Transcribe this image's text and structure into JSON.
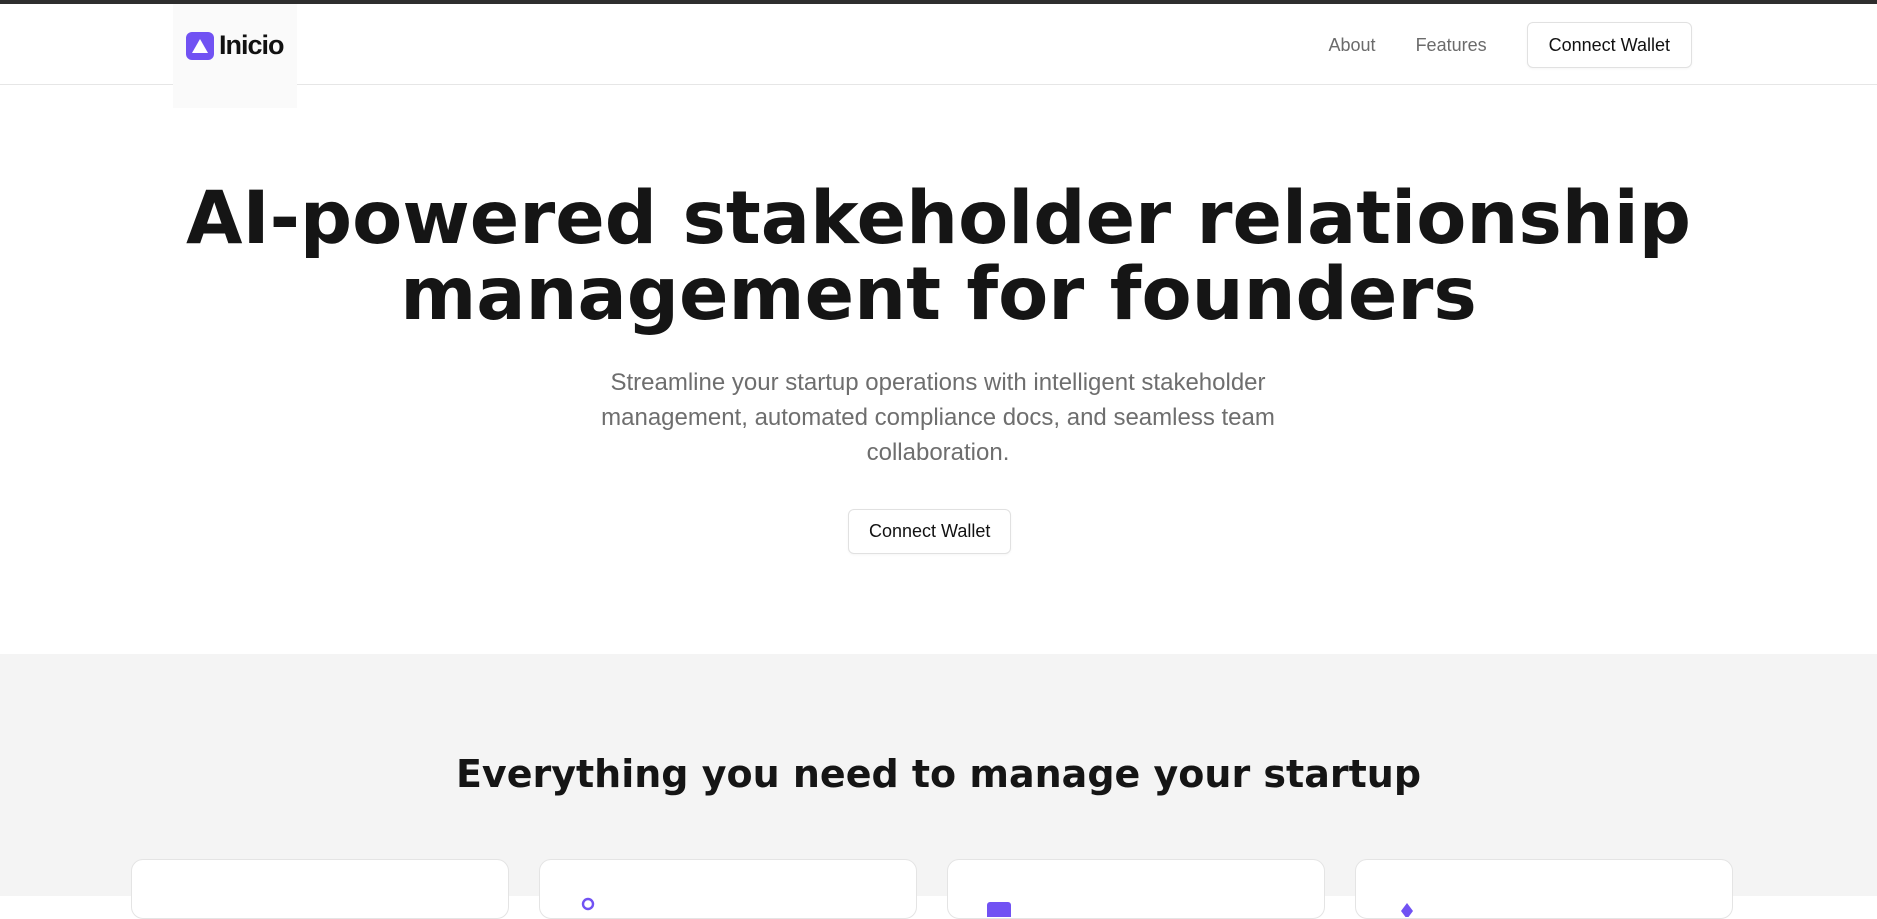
{
  "brand": {
    "name": "Inicio",
    "accent": "#7152f3"
  },
  "nav": {
    "links": [
      "About",
      "Features"
    ],
    "cta": "Connect Wallet"
  },
  "hero": {
    "title_line1": "AI-powered stakeholder relationship",
    "title_line2": "management for founders",
    "subtitle": "Streamline your startup operations with intelligent stakeholder management, automated compliance docs, and seamless team collaboration.",
    "cta": "Connect Wallet"
  },
  "features": {
    "title": "Everything you need to manage your startup",
    "cards": [
      {
        "icon": "users-icon"
      },
      {
        "icon": "document-icon"
      },
      {
        "icon": "square-icon"
      },
      {
        "icon": "diamond-icon"
      }
    ]
  }
}
